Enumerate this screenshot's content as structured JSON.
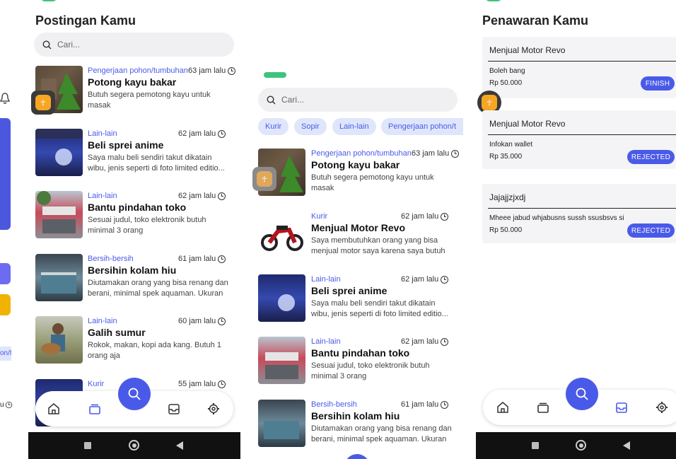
{
  "left_edge": {
    "chip_fragment": "on/t",
    "time_fragment": "u"
  },
  "screen1": {
    "title": "Postingan Kamu",
    "search_placeholder": "Cari...",
    "posts": [
      {
        "category": "Pengerjaan pohon/tumbuhan",
        "time": "63 jam lalu",
        "title": "Potong kayu bakar",
        "desc": "Butuh segera pemotong kayu untuk masak"
      },
      {
        "category": "Lain-lain",
        "time": "62 jam lalu",
        "title": "Beli sprei anime",
        "desc": "Saya malu beli sendiri takut dikatain wibu, jenis seperti di foto limited editio..."
      },
      {
        "category": "Lain-lain",
        "time": "62 jam lalu",
        "title": "Bantu pindahan toko",
        "desc": "Sesuai judul, toko elektronik butuh minimal 3 orang"
      },
      {
        "category": "Bersih-bersih",
        "time": "61 jam lalu",
        "title": "Bersihin kolam hiu",
        "desc": "Diutamakan orang yang bisa renang dan berani, minimal spek aquaman. Ukuran ..."
      },
      {
        "category": "Lain-lain",
        "time": "60 jam lalu",
        "title": "Galih sumur",
        "desc": "Rokok, makan, kopi ada kang. Butuh 1 orang aja"
      },
      {
        "category": "Kurir",
        "time": "55 jam lalu",
        "title": "",
        "desc": ""
      }
    ]
  },
  "screen2": {
    "search_placeholder": "Cari...",
    "chips": [
      "Kurir",
      "Sopir",
      "Lain-lain",
      "Pengerjaan pohon/t"
    ],
    "posts": [
      {
        "category": "Pengerjaan pohon/tumbuhan",
        "time": "63 jam lalu",
        "title": "Potong kayu bakar",
        "desc": "Butuh segera pemotong kayu untuk masak"
      },
      {
        "category": "Kurir",
        "time": "62 jam lalu",
        "title": "Menjual Motor Revo",
        "desc": "Saya membutuhkan orang yang bisa menjual motor saya karena saya butuh ..."
      },
      {
        "category": "Lain-lain",
        "time": "62 jam lalu",
        "title": "Beli sprei anime",
        "desc": "Saya malu beli sendiri takut dikatain wibu, jenis seperti di foto limited editio..."
      },
      {
        "category": "Lain-lain",
        "time": "62 jam lalu",
        "title": "Bantu pindahan toko",
        "desc": "Sesuai judul, toko elektronik butuh minimal 3 orang"
      },
      {
        "category": "Bersih-bersih",
        "time": "61 jam lalu",
        "title": "Bersihin kolam hiu",
        "desc": "Diutamakan orang yang bisa renang dan berani, minimal spek aquaman. Ukuran ..."
      }
    ]
  },
  "screen3": {
    "title": "Penawaran Kamu",
    "offers": [
      {
        "title": "Menjual Motor Revo",
        "desc": "Boleh bang",
        "price": "Rp 50.000",
        "status": "FINISH"
      },
      {
        "title": "Menjual Motor Revo",
        "desc": "Infokan wallet",
        "price": "Rp 35.000",
        "status": "REJECTED"
      },
      {
        "title": "Jajajjzjxdj",
        "desc": "Mheee jabud whjabusns sussh ssusbsvs si",
        "price": "Rp 50.000",
        "status": "REJECTED"
      }
    ]
  },
  "colors": {
    "accent": "#4a5ae8",
    "chip_bg": "#dfe6fb",
    "green": "#3cc47c",
    "amber": "#f4b400"
  }
}
